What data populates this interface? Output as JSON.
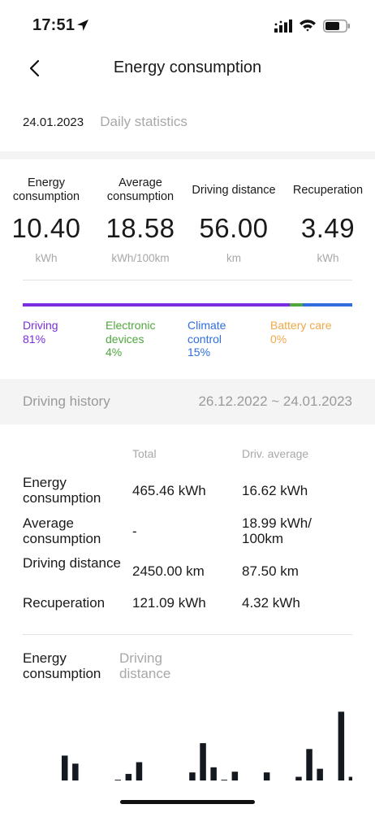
{
  "status": {
    "time": "17:51"
  },
  "nav": {
    "title": "Energy consumption"
  },
  "date": {
    "value": "24.01.2023",
    "mode": "Daily statistics"
  },
  "stats": [
    {
      "label": "Energy consumption",
      "value": "10.40",
      "unit": "kWh"
    },
    {
      "label": "Average consumption",
      "value": "18.58",
      "unit": "kWh/100km"
    },
    {
      "label": "Driving distance",
      "value": "56.00",
      "unit": "km"
    },
    {
      "label": "Recuperation",
      "value": "3.49",
      "unit": "kWh"
    }
  ],
  "breakdown": [
    {
      "label": "Driving",
      "percent_text": "81%",
      "fraction": 0.81,
      "color": "#7a2ee0"
    },
    {
      "label": "Electronic devices",
      "percent_text": "4%",
      "fraction": 0.04,
      "color": "#4fa83d"
    },
    {
      "label": "Climate control",
      "percent_text": "15%",
      "fraction": 0.15,
      "color": "#2f6de0"
    },
    {
      "label": "Battery care",
      "percent_text": "0%",
      "fraction": 0.0,
      "color": "#f0a848"
    }
  ],
  "history": {
    "label": "Driving history",
    "range": "26.12.2022 ~ 24.01.2023",
    "headers": {
      "total": "Total",
      "avg": "Driv. average"
    },
    "rows": [
      {
        "name": "Energy consumption",
        "total": "465.46 kWh",
        "avg": "16.62 kWh"
      },
      {
        "name": "Average consumption",
        "total": "-",
        "avg": "18.99 kWh/ 100km"
      },
      {
        "name": "Driving distance",
        "total": "2450.00 km",
        "avg": "87.50 km"
      },
      {
        "name": "Recuperation",
        "total": "121.09 kWh",
        "avg": "4.32 kWh"
      }
    ]
  },
  "chart_tabs": [
    {
      "label": "Energy consumption",
      "active": true
    },
    {
      "label": "Driving distance",
      "active": false
    }
  ],
  "chart_data": {
    "type": "bar",
    "ylim": [
      0,
      100
    ],
    "values": [
      34,
      23,
      0,
      0,
      0,
      1,
      9,
      25,
      0,
      0,
      0,
      0,
      11,
      51,
      18,
      1,
      12,
      0,
      0,
      11,
      0,
      0,
      5,
      43,
      16,
      0,
      94,
      5
    ],
    "color": "#14181f"
  }
}
